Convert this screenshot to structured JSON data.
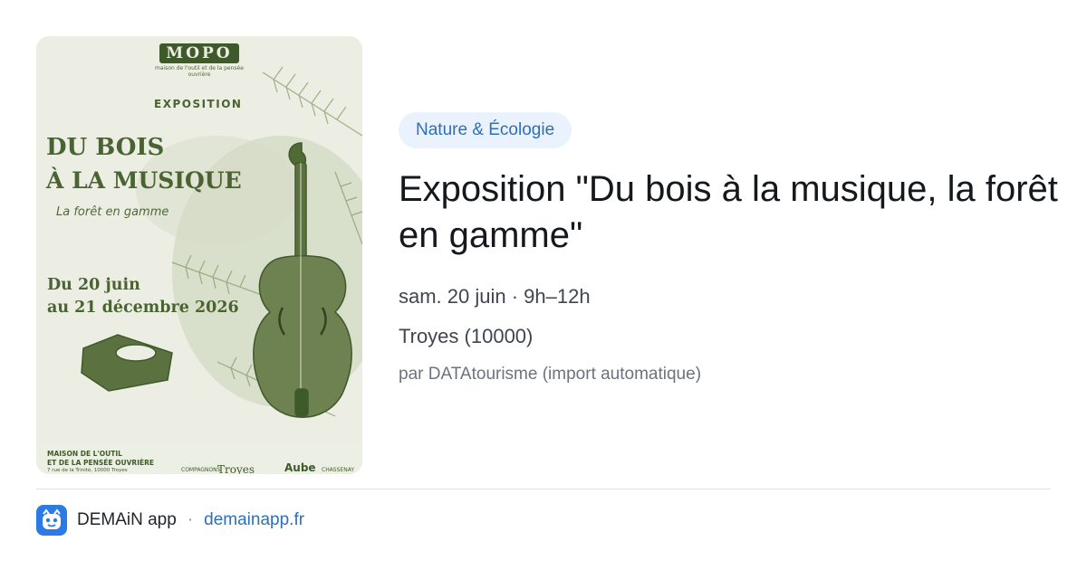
{
  "poster": {
    "logo": "MOPO",
    "logo_subtitle": "maison de l'outil et de la pensée ouvrière",
    "kicker": "EXPOSITION",
    "title_line1": "DU BOIS",
    "title_line2": "À LA MUSIQUE",
    "subtitle": "La forêt en gamme",
    "dates_line1": "Du 20 juin",
    "dates_line2": "au 21 décembre 2026",
    "organizer_line1": "MAISON DE L'OUTIL",
    "organizer_line2": "ET DE LA PENSÉE OUVRIÈRE",
    "address": "7 rue de la Trinité, 10000 Troyes",
    "partners": [
      "COMPAGNONS",
      "Troyes",
      "Aube",
      "CHASSENAY"
    ],
    "image_icon": "violin-illustration",
    "colors": {
      "ink": "#4a6331",
      "paper": "#eceee4"
    }
  },
  "event": {
    "category": "Nature & Écologie",
    "title": "Exposition \"Du bois à la musique, la forêt en gamme\"",
    "when": "sam. 20 juin · 9h–12h",
    "where": "Troyes (10000)",
    "source": "par DATAtourisme (import automatique)"
  },
  "footer": {
    "app_icon": "demain-app-icon",
    "app_name": "DEMAiN app",
    "separator": "·",
    "link_text": "demainapp.fr"
  },
  "colors": {
    "accent": "#2f6fb7",
    "tag_bg": "#eaf2fd",
    "title": "#15191d",
    "muted": "#6b7380"
  }
}
